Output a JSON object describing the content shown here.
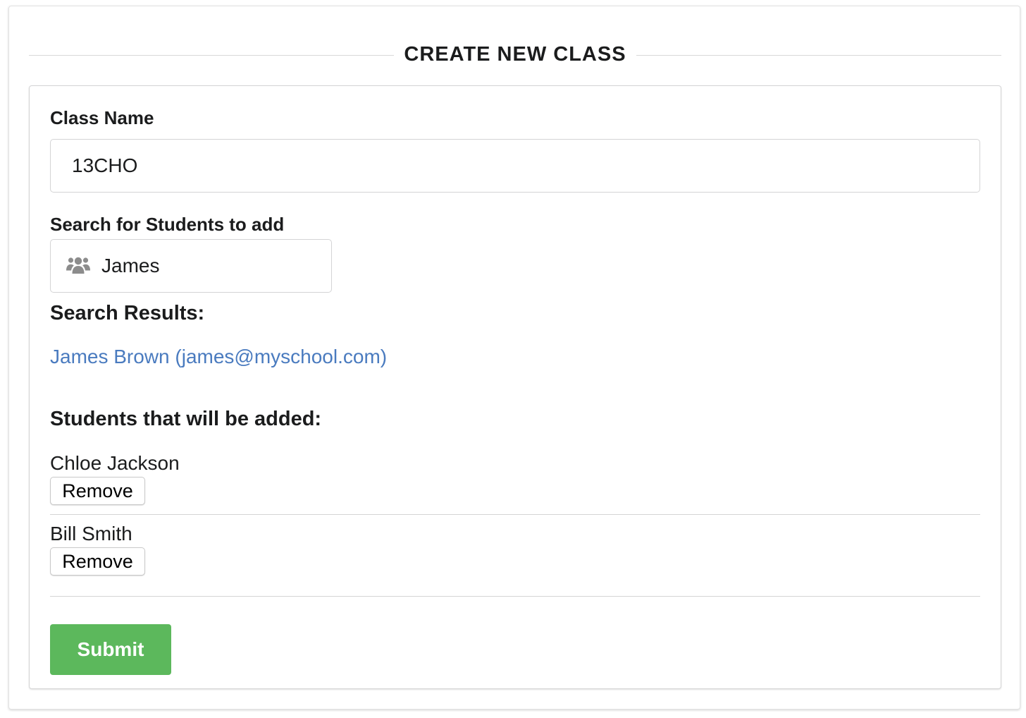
{
  "header": {
    "title": "CREATE NEW CLASS"
  },
  "form": {
    "class_name_label": "Class Name",
    "class_name_value": "13CHO",
    "search_label": "Search for Students to add",
    "search_value": "James",
    "search_icon": "users-icon",
    "results_heading": "Search Results:",
    "results": [
      {
        "text": "James Brown (james@myschool.com)"
      }
    ],
    "added_heading": "Students that will be added:",
    "students": [
      {
        "name": "Chloe Jackson",
        "remove_label": "Remove"
      },
      {
        "name": "Bill Smith",
        "remove_label": "Remove"
      }
    ],
    "submit_label": "Submit"
  },
  "colors": {
    "link": "#4a7bbf",
    "submit": "#5cb85c",
    "icon": "#8c8c8c"
  }
}
